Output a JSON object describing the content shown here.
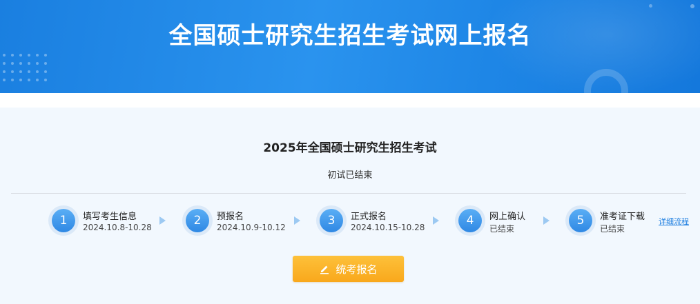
{
  "header": {
    "title": "全国硕士研究生招生考试网上报名"
  },
  "exam": {
    "title": "2025年全国硕士研究生招生考试",
    "status": "初试已结束"
  },
  "steps": [
    {
      "number": "1",
      "label": "填写考生信息",
      "date": "2024.10.8-10.28"
    },
    {
      "number": "2",
      "label": "预报名",
      "date": "2024.10.9-10.12"
    },
    {
      "number": "3",
      "label": "正式报名",
      "date": "2024.10.15-10.28"
    },
    {
      "number": "4",
      "label": "网上确认",
      "date": "已结束"
    },
    {
      "number": "5",
      "label": "准考证下载",
      "date": "已结束"
    }
  ],
  "links": {
    "detail_flow": "详细流程"
  },
  "actions": {
    "register_label": "统考报名",
    "register_icon": "pencil-icon"
  },
  "colors": {
    "banner": "#1e86e6",
    "panel": "#f2f8fe",
    "step_circle": "#2f88e4",
    "button": "#f9a81c",
    "link": "#1d7ee0"
  }
}
